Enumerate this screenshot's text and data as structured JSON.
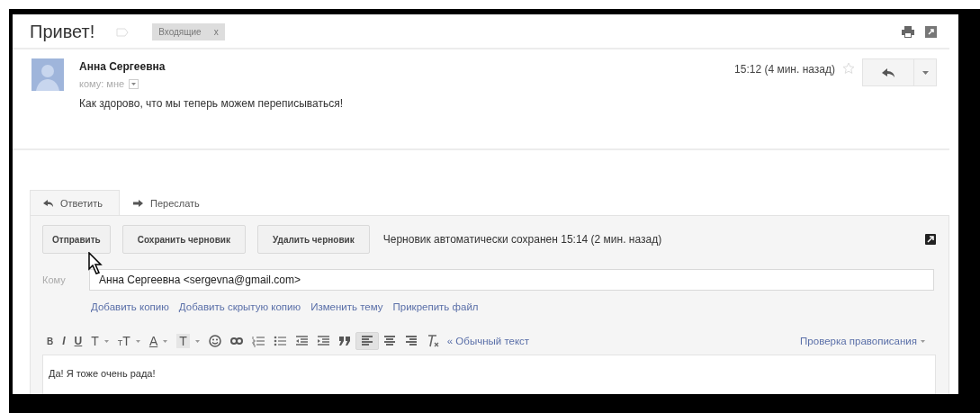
{
  "header": {
    "subject": "Привет!",
    "labels": [
      {
        "text": "Входящие",
        "close": "x"
      }
    ]
  },
  "message": {
    "sender": "Анна Сергеевна",
    "recipient": "кому: мне",
    "time": "15:12 (4 мин. назад)",
    "starred": false,
    "body": "Как здорово, что мы теперь можем переписываться!"
  },
  "compose": {
    "tabs": [
      {
        "label": "Ответить",
        "kind": "reply",
        "selected": true
      },
      {
        "label": "Переслать",
        "kind": "forward",
        "selected": false
      }
    ],
    "buttons": [
      "Отправить",
      "Сохранить черновик",
      "Удалить черновик"
    ],
    "draft_status": "Черновик автоматически сохранен 15:14 (2 мин. назад)",
    "to_label": "Кому",
    "to_value": "Анна Сергеевна <sergevna@gmail.com>",
    "links": [
      "Добавить копию",
      "Добавить скрытую копию",
      "Изменить тему",
      "Прикрепить файл"
    ],
    "toolbar": [
      {
        "kind": "bold",
        "label": "B",
        "selected": false
      },
      {
        "kind": "italic",
        "label": "I",
        "selected": false
      },
      {
        "kind": "underline",
        "label": "U",
        "selected": false
      },
      {
        "kind": "font",
        "label": "T",
        "selected": false
      },
      {
        "kind": "size",
        "label": "TT",
        "selected": false
      },
      {
        "kind": "text-color",
        "label": "A",
        "selected": false
      },
      {
        "kind": "highlight",
        "label": "T",
        "selected": false
      },
      {
        "kind": "emoji",
        "selected": false
      },
      {
        "kind": "link",
        "selected": false
      },
      {
        "kind": "numbered-list",
        "selected": false
      },
      {
        "kind": "bulleted-list",
        "selected": false
      },
      {
        "kind": "indent-less",
        "selected": false
      },
      {
        "kind": "indent-more",
        "selected": false
      },
      {
        "kind": "quote",
        "selected": false
      },
      {
        "kind": "align-left",
        "selected": true
      },
      {
        "kind": "align-center",
        "selected": false
      },
      {
        "kind": "align-right",
        "selected": false
      },
      {
        "kind": "clear-formatting",
        "selected": false
      }
    ],
    "plain_text_link": "« Обычный текст",
    "spellcheck": "Проверка правописания",
    "body": "Да! Я тоже очень рада!"
  }
}
